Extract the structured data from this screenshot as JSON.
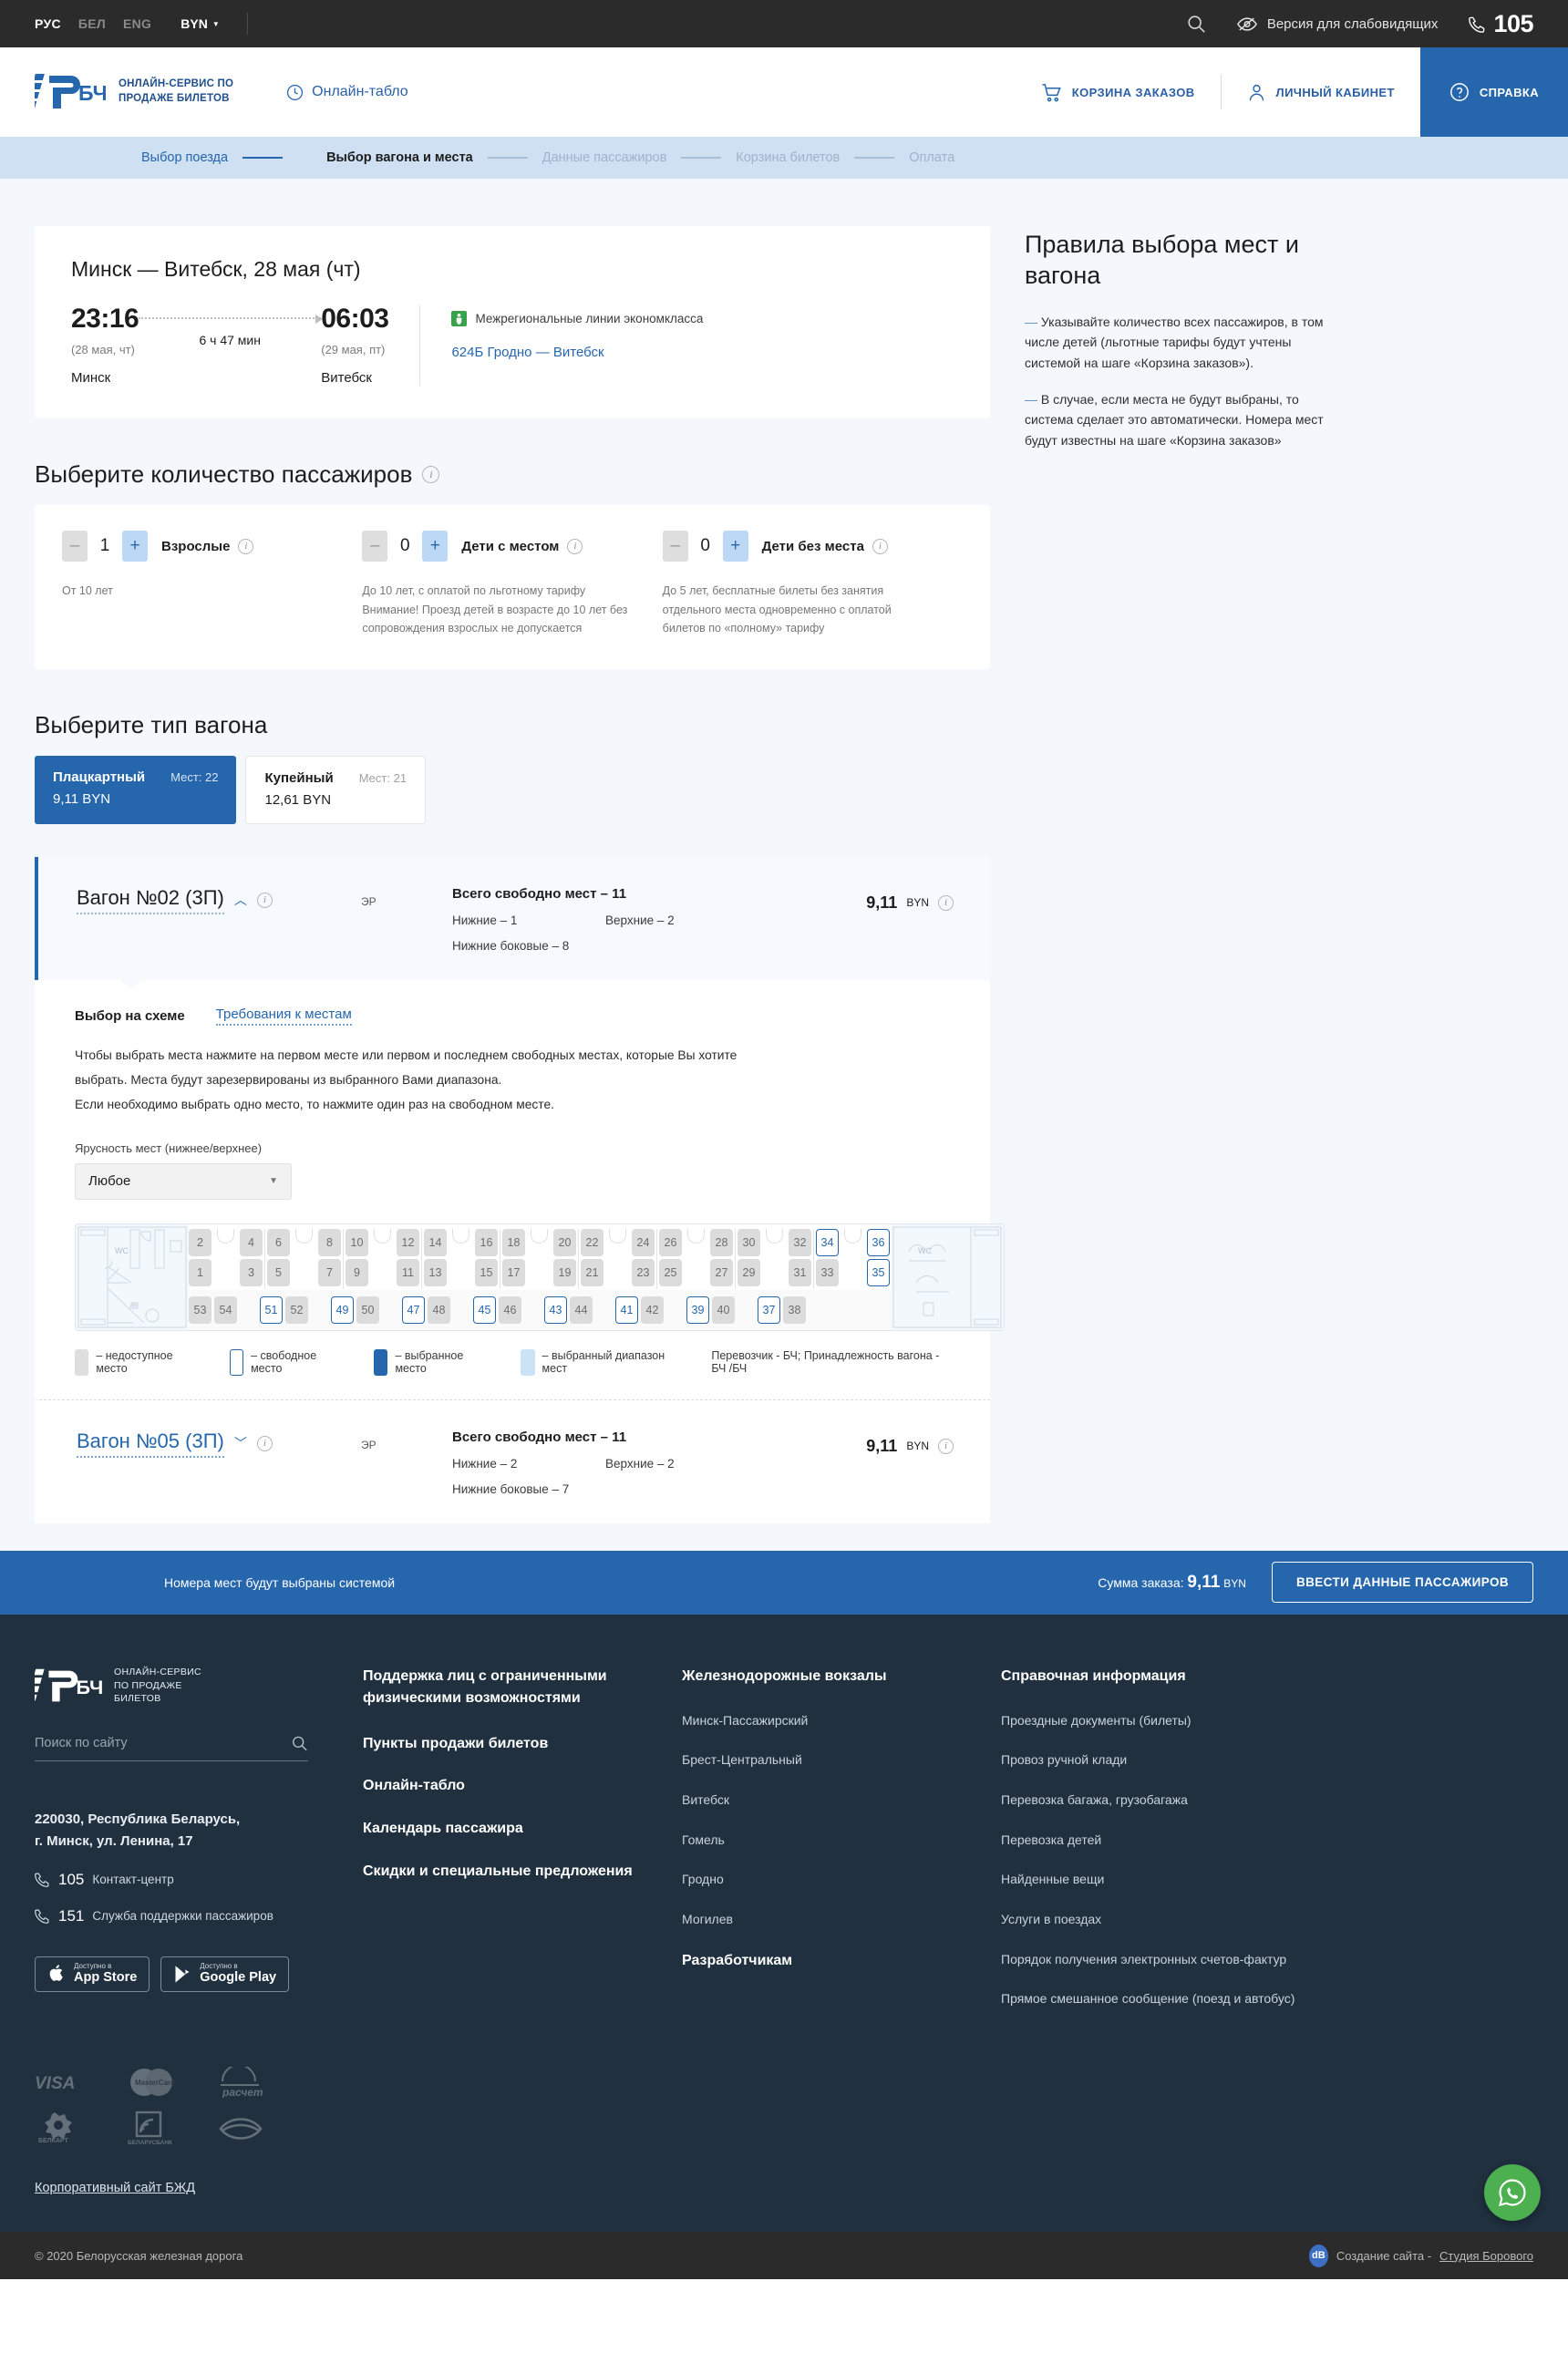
{
  "topbar": {
    "languages": [
      {
        "code": "РУС",
        "active": true
      },
      {
        "code": "БЕЛ",
        "active": false
      },
      {
        "code": "ENG",
        "active": false
      }
    ],
    "currency": "BYN",
    "search_icon": "search-icon",
    "vision_label": "Версия для слабовидящих",
    "phone": "105"
  },
  "header": {
    "logo_mark": "БЧ",
    "logo_line1": "Онлайн-сервис по",
    "logo_line2": "продаже билетов",
    "online_board": "Онлайн-табло",
    "cart": "Корзина заказов",
    "account": "Личный кабинет",
    "help": "Справка"
  },
  "breadcrumbs": [
    {
      "label": "Выбор поезда",
      "state": "done"
    },
    {
      "label": "Выбор вагона и места",
      "state": "current"
    },
    {
      "label": "Данные пассажиров",
      "state": "next"
    },
    {
      "label": "Корзина билетов",
      "state": "next"
    },
    {
      "label": "Оплата",
      "state": "next"
    }
  ],
  "trip": {
    "title": "Минск — Витебск, 28 мая (чт)",
    "depart_time": "23:16",
    "depart_date": "(28 мая, чт)",
    "depart_city": "Минск",
    "duration": "6 ч 47 мин",
    "arrive_time": "06:03",
    "arrive_date": "(29 мая, пт)",
    "arrive_city": "Витебск",
    "class_label": "Межрегиональные линии экономкласса",
    "train": "624Б Гродно — Витебск"
  },
  "rules": {
    "title": "Правила выбора мест и вагона",
    "items": [
      "Указывайте количество всех пассажиров, в том числе детей (льготные тарифы будут учтены системой на шаге «Корзина заказов»).",
      "В случае, если места не будут выбраны, то система сделает это автоматически. Номера мест будут известны на шаге «Корзина заказов»"
    ]
  },
  "passengers": {
    "heading": "Выберите количество пассажиров",
    "groups": [
      {
        "label": "Взрослые",
        "value": "1",
        "minus": "–",
        "plus": "+",
        "note": "От 10 лет"
      },
      {
        "label": "Дети с местом",
        "value": "0",
        "minus": "–",
        "plus": "+",
        "note": "До 10 лет, с оплатой по льготному тарифу Внимание! Проезд детей в возрасте до 10 лет без сопровождения взрослых не допускается"
      },
      {
        "label": "Дети без места",
        "value": "0",
        "minus": "–",
        "plus": "+",
        "note": "До 5 лет, бесплатные билеты без занятия отдельного места одновременно с оплатой билетов по «полному» тарифу"
      }
    ]
  },
  "car_types": {
    "heading": "Выберите тип вагона",
    "options": [
      {
        "name": "Плацкартный",
        "seats_label": "Мест: 22",
        "price": "9,11 BYN",
        "selected": true
      },
      {
        "name": "Купейный",
        "seats_label": "Мест: 21",
        "price": "12,61 BYN",
        "selected": false
      }
    ]
  },
  "wagons": [
    {
      "name": "Вагон №02 (3П)",
      "carrier_code": "ЭР",
      "total_label": "Всего свободно мест – 11",
      "lower": "Нижние – 1",
      "upper": "Верхние – 2",
      "lower_side": "Нижние боковые – 8",
      "price": "9,11",
      "currency": "BYN",
      "expanded": true
    },
    {
      "name": "Вагон №05 (3П)",
      "carrier_code": "ЭР",
      "total_label": "Всего свободно мест – 11",
      "lower": "Нижние – 2",
      "upper": "Верхние – 2",
      "lower_side": "Нижние боковые – 7",
      "price": "9,11",
      "currency": "BYN",
      "expanded": false
    }
  ],
  "scheme": {
    "tab_scheme": "Выбор на схеме",
    "tab_requirements": "Требования к местам",
    "instructions_line1": "Чтобы выбрать места нажмите на первом месте или первом и последнем свободных местах, которые Вы хотите",
    "instructions_line2": "выбрать. Места будут зарезервированы из выбранного Вами диапазона.",
    "instructions_line3": "Если необходимо выбрать одно место, то нажмите один раз на свободном месте.",
    "tier_label": "Ярусность мест (нижнее/верхнее)",
    "tier_value": "Любое",
    "wc_label": "WC",
    "seats_upper": [
      2,
      4,
      6,
      8,
      10,
      12,
      14,
      16,
      18,
      20,
      22,
      24,
      26,
      28,
      30,
      32,
      34,
      36
    ],
    "seats_lower": [
      1,
      3,
      5,
      7,
      9,
      11,
      13,
      15,
      17,
      19,
      21,
      23,
      25,
      27,
      29,
      31,
      33,
      35
    ],
    "seats_side": [
      53,
      54,
      51,
      52,
      49,
      50,
      47,
      48,
      45,
      46,
      43,
      44,
      41,
      42,
      39,
      40,
      37,
      38
    ],
    "free_seats": [
      34,
      36,
      35,
      51,
      49,
      47,
      45,
      43,
      41,
      39,
      37
    ],
    "legend": [
      {
        "label": "– недоступное место",
        "kind": "na"
      },
      {
        "label": "– свободное место",
        "kind": "fr"
      },
      {
        "label": "– выбранное место",
        "kind": "se"
      },
      {
        "label": "– выбранный диапазон мест",
        "kind": "rg"
      }
    ],
    "carrier_note": "Перевозчик - БЧ; Принадлежность вагона - БЧ /БЧ"
  },
  "action_bar": {
    "note": "Номера мест будут выбраны системой",
    "sum_label": "Сумма заказа:",
    "sum_value": "9,11",
    "sum_currency": "BYN",
    "button": "Ввести данные пассажиров"
  },
  "footer": {
    "logo_mark": "БЧ",
    "logo_line1": "Онлайн-сервис",
    "logo_line2": "по продаже",
    "logo_line3": "билетов",
    "search_placeholder": "Поиск по сайту",
    "address_line1": "220030, Республика Беларусь,",
    "address_line2": "г. Минск, ул. Ленина, 17",
    "phone1_num": "105",
    "phone1_text": "Контакт-центр",
    "phone2_num": "151",
    "phone2_text": "Служба поддержки пассажиров",
    "appstore_small": "Доступно в",
    "appstore_big": "App Store",
    "googleplay_small": "Доступно в",
    "googleplay_big": "Google Play",
    "col2": [
      {
        "label": "Поддержка лиц с ограниченными физическими возможностями",
        "bold": true
      },
      {
        "label": "Пункты продажи билетов",
        "bold": true
      },
      {
        "label": "Онлайн-табло",
        "bold": true
      },
      {
        "label": "Календарь пассажира",
        "bold": true
      },
      {
        "label": "Скидки и специальные предложения",
        "bold": true
      }
    ],
    "col3_title": "Железнодорожные вокзалы",
    "col3": [
      "Минск-Пассажирский",
      "Брест-Центральный",
      "Витебск",
      "Гомель",
      "Гродно",
      "Могилев"
    ],
    "col3_extra": "Разработчикам",
    "col4_title": "Справочная информация",
    "col4": [
      "Проездные документы (билеты)",
      "Провоз ручной клади",
      "Перевозка багажа, грузобагажа",
      "Перевозка детей",
      "Найденные вещи",
      "Услуги в поездах",
      "Порядок получения электронных счетов-фактур",
      "Прямое смешанное сообщение (поезд и автобус)"
    ],
    "payments": [
      "VISA",
      "MasterCard",
      "расчет",
      "БЕЛКАРТ",
      "БЕЛАРУСБАНК",
      "ЕРИП"
    ],
    "corporate_link": "Корпоративный сайт БЖД",
    "copyright": "© 2020 Белорусская железная дорога",
    "made_by_prefix": "Создание сайта -",
    "made_by": "Студия Борового",
    "made_by_logo": "dB"
  },
  "colors": {
    "accent": "#2566ad",
    "topbar": "#2b2b2b",
    "crumbs": "#cfe0f2",
    "footer": "#20303f",
    "whatsapp": "#4caf50"
  }
}
